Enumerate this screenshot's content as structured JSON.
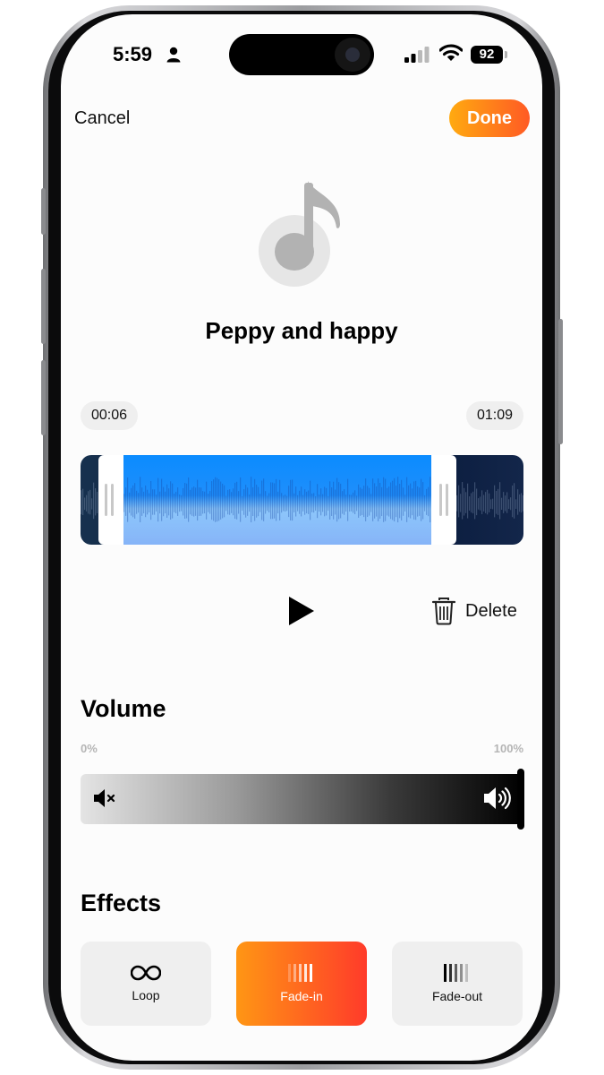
{
  "status_bar": {
    "time": "5:59",
    "battery": "92",
    "icons": [
      "person-icon",
      "signal-icon",
      "wifi-icon",
      "battery-icon"
    ]
  },
  "nav": {
    "cancel_label": "Cancel",
    "done_label": "Done",
    "accent_gradient": [
      "#ffaa10",
      "#ff5a24"
    ]
  },
  "track": {
    "icon": "music-note-icon",
    "title": "Peppy and happy"
  },
  "trim": {
    "start_time": "00:06",
    "end_time": "01:09"
  },
  "controls": {
    "play_icon": "play-icon",
    "delete_label": "Delete",
    "delete_icon": "trash-icon"
  },
  "volume": {
    "title": "Volume",
    "min_label": "0%",
    "max_label": "100%",
    "level_percent": 100
  },
  "effects": {
    "title": "Effects",
    "items": [
      {
        "label": "Loop",
        "icon": "loop-icon",
        "selected": false
      },
      {
        "label": "Fade-in",
        "icon": "fade-in-icon",
        "selected": true
      },
      {
        "label": "Fade-out",
        "icon": "fade-out-icon",
        "selected": false
      }
    ]
  }
}
